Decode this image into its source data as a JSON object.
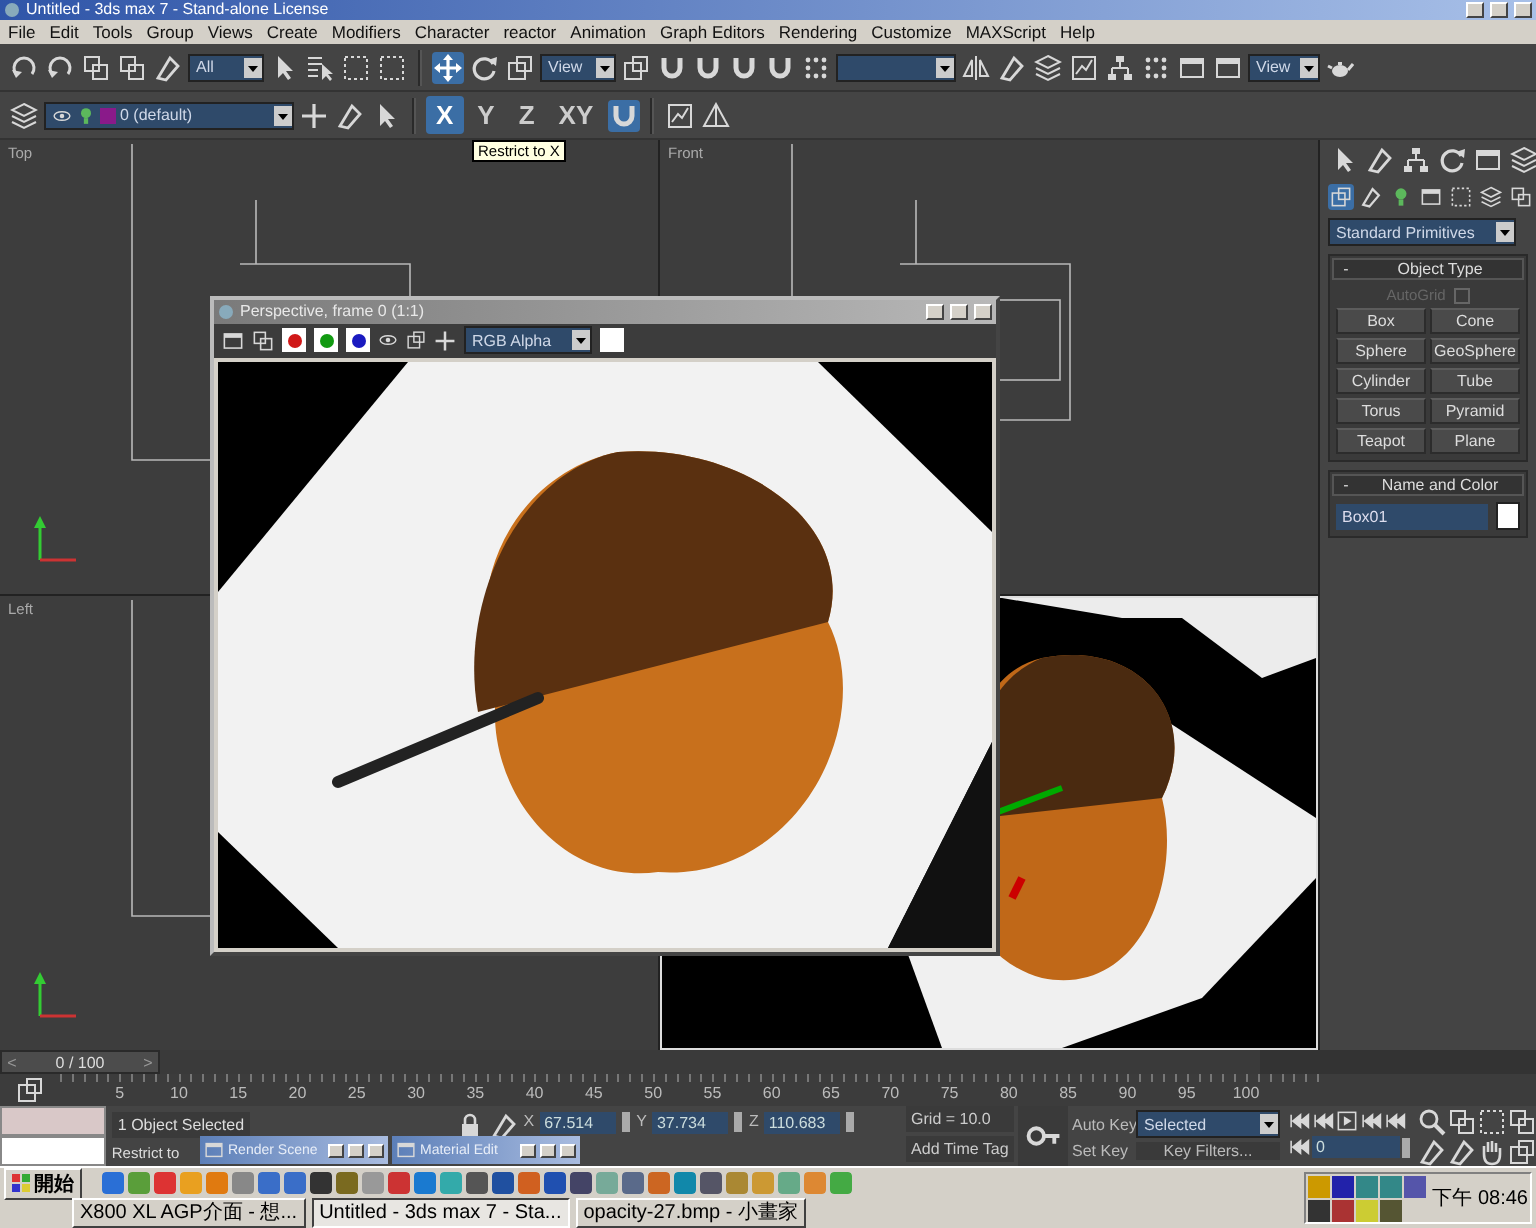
{
  "window": {
    "title": "Untitled - 3ds max 7 - Stand-alone License"
  },
  "menu": [
    "File",
    "Edit",
    "Tools",
    "Group",
    "Views",
    "Create",
    "Modifiers",
    "Character",
    "reactor",
    "Animation",
    "Graph Editors",
    "Rendering",
    "Customize",
    "MAXScript",
    "Help"
  ],
  "toolbar": {
    "selection_filter": "All",
    "reference_coordinate": "View",
    "render_type": "View"
  },
  "transform_tools": [
    {
      "kind": "move",
      "selected": true
    },
    {
      "kind": "rotate",
      "selected": false
    },
    {
      "kind": "scale",
      "selected": false
    }
  ],
  "layer": {
    "name": "0 (default)"
  },
  "axis_buttons": [
    {
      "label": "X",
      "selected": true
    },
    {
      "label": "Y",
      "selected": false
    },
    {
      "label": "Z",
      "selected": false
    },
    {
      "label": "XY",
      "selected": false
    }
  ],
  "snap_toggle": {
    "on": true
  },
  "tooltip": "Restrict to X",
  "viewports": [
    {
      "label": "Top",
      "kind": "wire"
    },
    {
      "label": "Front",
      "kind": "wire"
    },
    {
      "label": "Left",
      "kind": "wire"
    },
    {
      "kind": "shaded"
    }
  ],
  "render_window": {
    "title": "Perspective, frame 0 (1:1)",
    "channel": "RGB Alpha",
    "channels": [
      {
        "color": "#d01818",
        "on": true
      },
      {
        "color": "#129a12",
        "on": true
      },
      {
        "color": "#1a1ac0",
        "on": true
      }
    ]
  },
  "command_panel": {
    "categories": [
      {
        "selected": true
      },
      {
        "selected": false
      },
      {
        "selected": false
      },
      {
        "selected": false
      },
      {
        "selected": false
      },
      {
        "selected": false
      },
      {
        "selected": false
      }
    ],
    "dropdown": "Standard Primitives",
    "object_type": {
      "sign": "-",
      "title": "Object Type",
      "autogrid": {
        "label": "AutoGrid",
        "checked": false
      },
      "buttons": [
        "Box",
        "Cone",
        "Sphere",
        "GeoSphere",
        "Cylinder",
        "Tube",
        "Torus",
        "Pyramid",
        "Teapot",
        "Plane"
      ]
    },
    "name_and_color": {
      "sign": "-",
      "title": "Name and Color",
      "name": "Box01",
      "color": "#ffffff"
    }
  },
  "time_slider": {
    "prev": "<",
    "position": "0 / 100",
    "next": ">",
    "level": 0
  },
  "frame_labels": [
    "5",
    "10",
    "15",
    "20",
    "25",
    "30",
    "35",
    "40",
    "45",
    "50",
    "55",
    "60",
    "65",
    "70",
    "75",
    "80",
    "85",
    "90",
    "95",
    "100"
  ],
  "status": {
    "selection": "1 Object Selected",
    "prompt": "Restrict to",
    "coordinates": [
      {
        "axis": "X",
        "value": "67.514"
      },
      {
        "axis": "Y",
        "value": "37.734"
      },
      {
        "axis": "Z",
        "value": "110.683"
      }
    ],
    "grid": "Grid = 10.0",
    "time_tag": "Add Time Tag",
    "auto_key": "Auto Key",
    "key_mode": "Selected",
    "set_key": "Set Key",
    "key_filters": "Key Filters...",
    "frame": "0"
  },
  "minimized_windows": [
    {
      "title": "Render Scene"
    },
    {
      "title": "Material Edit"
    }
  ],
  "taskbar": {
    "start": "開始",
    "tasks": [
      {
        "label": "X800 XL AGP介面 - 想...",
        "selected": false
      },
      {
        "label": "Untitled - 3ds max 7 - Sta...",
        "selected": true
      },
      {
        "label": "opacity-27.bmp - 小畫家",
        "selected": false
      }
    ],
    "clock": "下午 08:46"
  }
}
